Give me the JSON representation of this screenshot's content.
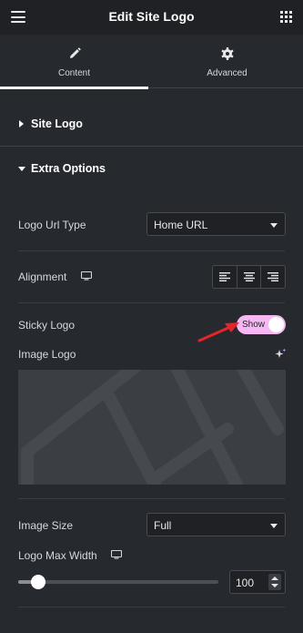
{
  "header": {
    "title": "Edit Site Logo",
    "menu_icon": "hamburger-icon",
    "apps_icon": "grid-icon"
  },
  "tabs": [
    {
      "label": "Content",
      "icon": "pencil-icon",
      "active": true
    },
    {
      "label": "Advanced",
      "icon": "gear-icon",
      "active": false
    }
  ],
  "sections": {
    "site_logo": {
      "label": "Site Logo",
      "expanded": false
    },
    "extra_options": {
      "label": "Extra Options",
      "expanded": true
    }
  },
  "controls": {
    "logo_url_type": {
      "label": "Logo Url Type",
      "value": "Home URL"
    },
    "alignment": {
      "label": "Alignment",
      "icons": [
        "align-left-icon",
        "align-center-icon",
        "align-right-icon"
      ]
    },
    "sticky_logo": {
      "label": "Sticky Logo",
      "toggle_label": "Show",
      "enabled": true
    },
    "image_logo": {
      "label": "Image Logo"
    },
    "image_size": {
      "label": "Image Size",
      "value": "Full"
    },
    "logo_max_width": {
      "label": "Logo Max Width",
      "value": "100",
      "slider_fraction": 0.1
    }
  },
  "colors": {
    "panel_bg": "#26292e",
    "header_bg": "#1f2124",
    "toggle_on": "#f5b8f3",
    "annotation_arrow": "#e3262a"
  }
}
